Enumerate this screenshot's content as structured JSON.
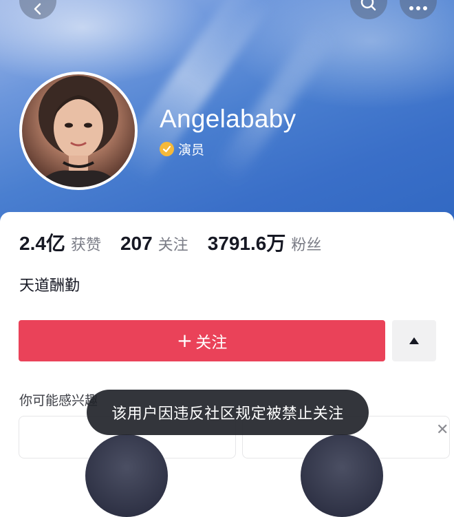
{
  "profile": {
    "username": "Angelababy",
    "verify_label": "演员",
    "bio": "天道酬勤"
  },
  "stats": [
    {
      "value": "2.4亿",
      "label": "获赞"
    },
    {
      "value": "207",
      "label": "关注"
    },
    {
      "value": "3791.6万",
      "label": "粉丝"
    }
  ],
  "actions": {
    "follow_plus": "+",
    "follow_label": "关注"
  },
  "suggestions": {
    "title": "你可能感兴趣"
  },
  "toast": {
    "message": "该用户因违反社区规定被禁止关注"
  },
  "colors": {
    "follow_button": "#ea4259",
    "verify_badge": "#f5b93a",
    "hero_blue": "#3a6fc8"
  },
  "icons": {
    "back": "chevron-left-icon",
    "search": "search-icon",
    "more": "more-dots-icon",
    "verified": "verified-check-icon",
    "expand": "triangle-up-icon",
    "close": "close-icon"
  }
}
